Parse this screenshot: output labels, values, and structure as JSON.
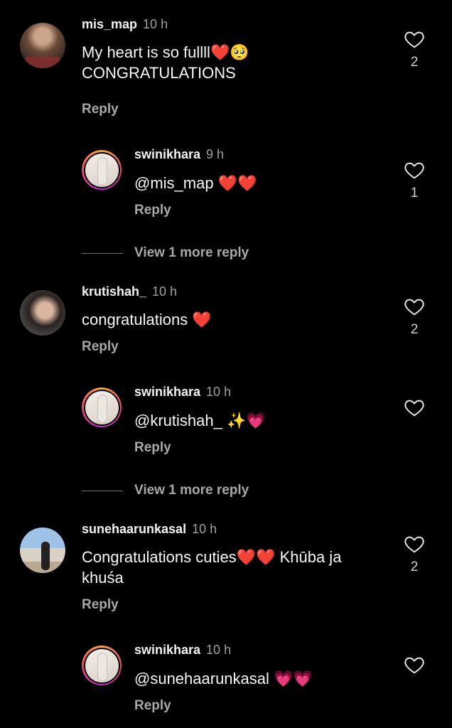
{
  "comments": [
    {
      "username": "mis_map",
      "time": "10 h",
      "text": "My heart is so fullll❤️🥺 CONGRATULATIONS",
      "reply_label": "Reply",
      "likes": "2",
      "replies": [
        {
          "username": "swinikhara",
          "time": "9 h",
          "text": "@mis_map ❤️❤️",
          "reply_label": "Reply",
          "likes": "1"
        }
      ],
      "view_more": "View 1 more reply"
    },
    {
      "username": "krutishah_",
      "time": "10 h",
      "text": "congratulations ❤️",
      "reply_label": "Reply",
      "likes": "2",
      "replies": [
        {
          "username": "swinikhara",
          "time": "10 h",
          "text": "@krutishah_ ✨💗",
          "reply_label": "Reply",
          "likes": ""
        }
      ],
      "view_more": "View 1 more reply"
    },
    {
      "username": "sunehaarunkasal",
      "time": "10 h",
      "text": "Congratulations cuties❤️❤️ Khūba ja khuśa",
      "reply_label": "Reply",
      "likes": "2",
      "replies": [
        {
          "username": "swinikhara",
          "time": "10 h",
          "text": "@sunehaarunkasal 💗💗",
          "reply_label": "Reply",
          "likes": ""
        }
      ]
    }
  ],
  "icons": {
    "like": "heart-outline-icon"
  },
  "colors": {
    "background": "#000000",
    "secondary_text": "#a8a8a8",
    "story_ring": "#e94b6c"
  }
}
